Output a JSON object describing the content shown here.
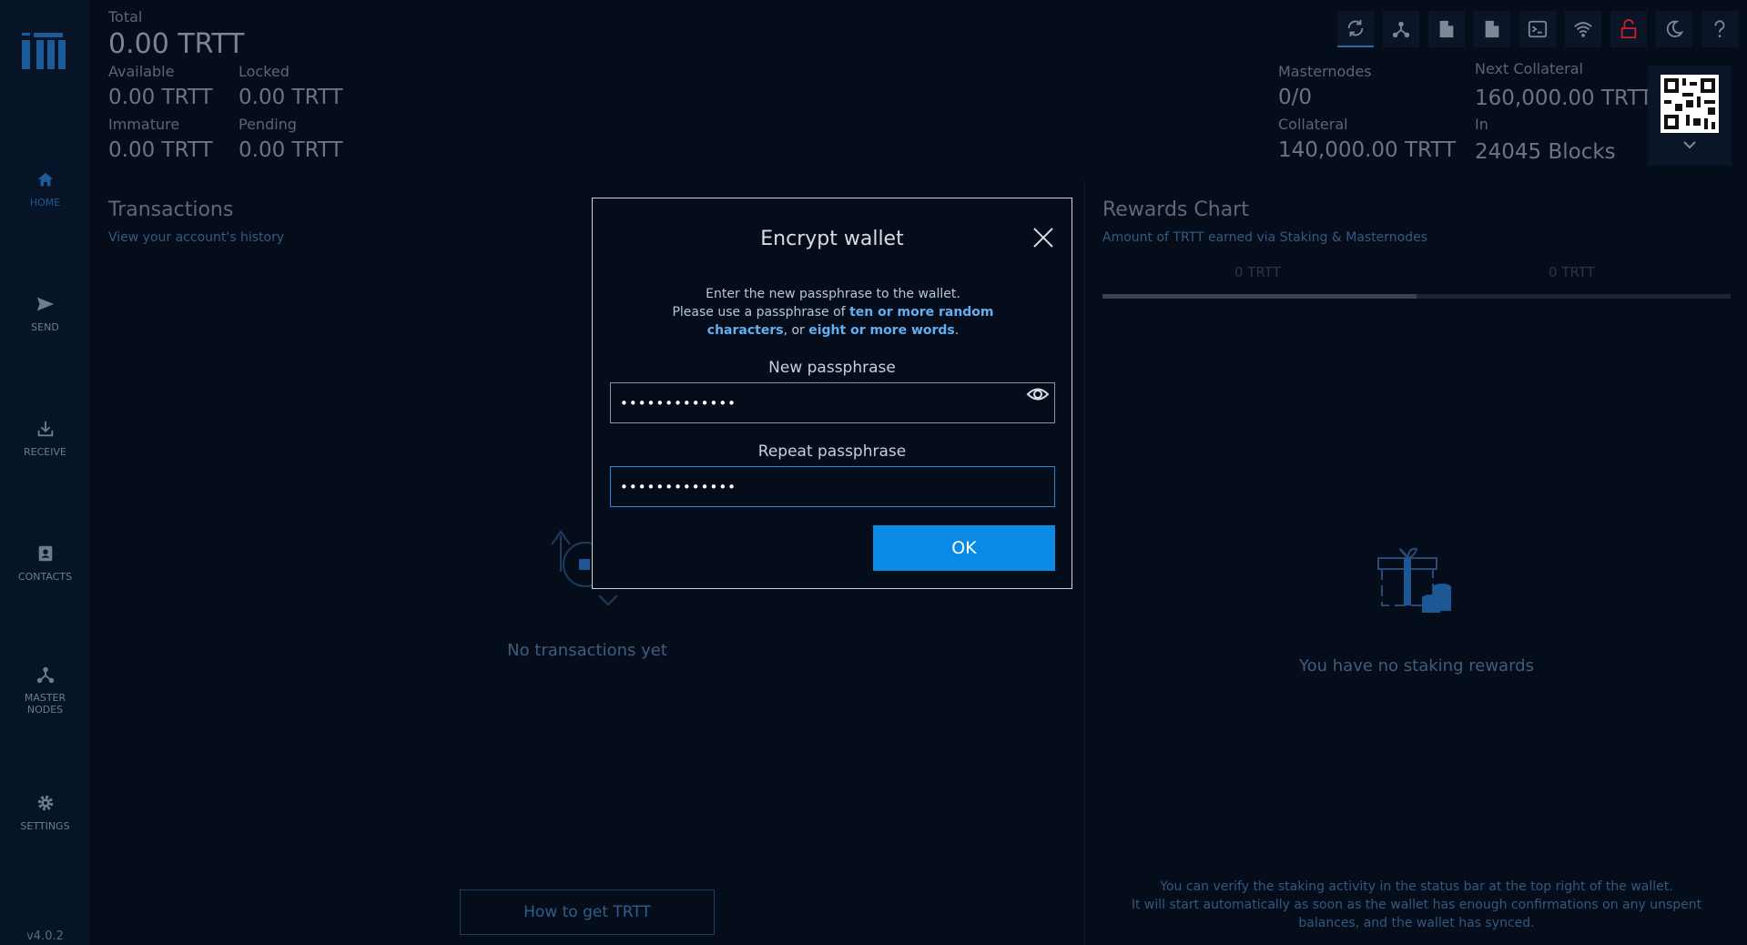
{
  "app": {
    "version": "v4.0.2",
    "colors": {
      "accent": "#0a8ae5",
      "bg": "#050d1a",
      "sidebar": "#071326",
      "highlight": "#63aef0",
      "danger": "#c8202a"
    }
  },
  "sidebar": {
    "items": [
      {
        "label": "HOME",
        "icon": "home-icon",
        "active": true
      },
      {
        "label": "SEND",
        "icon": "send-icon"
      },
      {
        "label": "RECEIVE",
        "icon": "receive-icon"
      },
      {
        "label": "CONTACTS",
        "icon": "contacts-icon"
      },
      {
        "label_line1": "MASTER",
        "label_line2": "NODES",
        "icon": "masternodes-icon"
      },
      {
        "label": "SETTINGS",
        "icon": "gear-icon"
      }
    ]
  },
  "balances": {
    "total_label": "Total",
    "total_value": "0.00 TRTT",
    "available_label": "Available",
    "available_value": "0.00 TRTT",
    "locked_label": "Locked",
    "locked_value": "0.00 TRTT",
    "immature_label": "Immature",
    "immature_value": "0.00 TRTT",
    "pending_label": "Pending",
    "pending_value": "0.00 TRTT"
  },
  "masternodes": {
    "count_label": "Masternodes",
    "count_value": "0/0",
    "collateral_label": "Collateral",
    "collateral_value": "140,000.00 TRTT",
    "next_collateral_label": "Next Collateral",
    "next_collateral_value": "160,000.00 TRTT",
    "in_label": "In",
    "in_value": "24045 Blocks"
  },
  "toolbar": {
    "icons": [
      "sync-icon",
      "network-icon",
      "document-icon",
      "document-icon",
      "console-icon",
      "wifi-icon",
      "unlocked-icon",
      "moon-icon",
      "help-icon"
    ]
  },
  "transactions": {
    "title": "Transactions",
    "subtitle": "View your account's history",
    "empty_text": "No transactions yet",
    "how_to_button": "How to get TRTT"
  },
  "rewards": {
    "title": "Rewards Chart",
    "subtitle": "Amount of TRTT earned via Staking & Masternodes",
    "tab_left": "0 TRTT",
    "tab_right": "0 TRTT",
    "empty_text": "You have no staking rewards",
    "footer_line1": "You can verify the staking activity in the status bar at the top right of the wallet.",
    "footer_line2": "It will start automatically as soon as the wallet has enough confirmations on any unspent",
    "footer_line3": "balances, and the wallet has synced."
  },
  "dialog": {
    "title": "Encrypt wallet",
    "desc_line1": "Enter the new passphrase to the wallet.",
    "desc_line2_pre": "Please use a passphrase of ",
    "desc_bold1": "ten or more random characters",
    "desc_mid": ", or ",
    "desc_bold2": "eight or more words",
    "desc_end": ".",
    "new_label": "New passphrase",
    "new_value": "•••••••••••••",
    "repeat_label": "Repeat passphrase",
    "repeat_value": "•••••••••••••",
    "ok_label": "OK"
  }
}
